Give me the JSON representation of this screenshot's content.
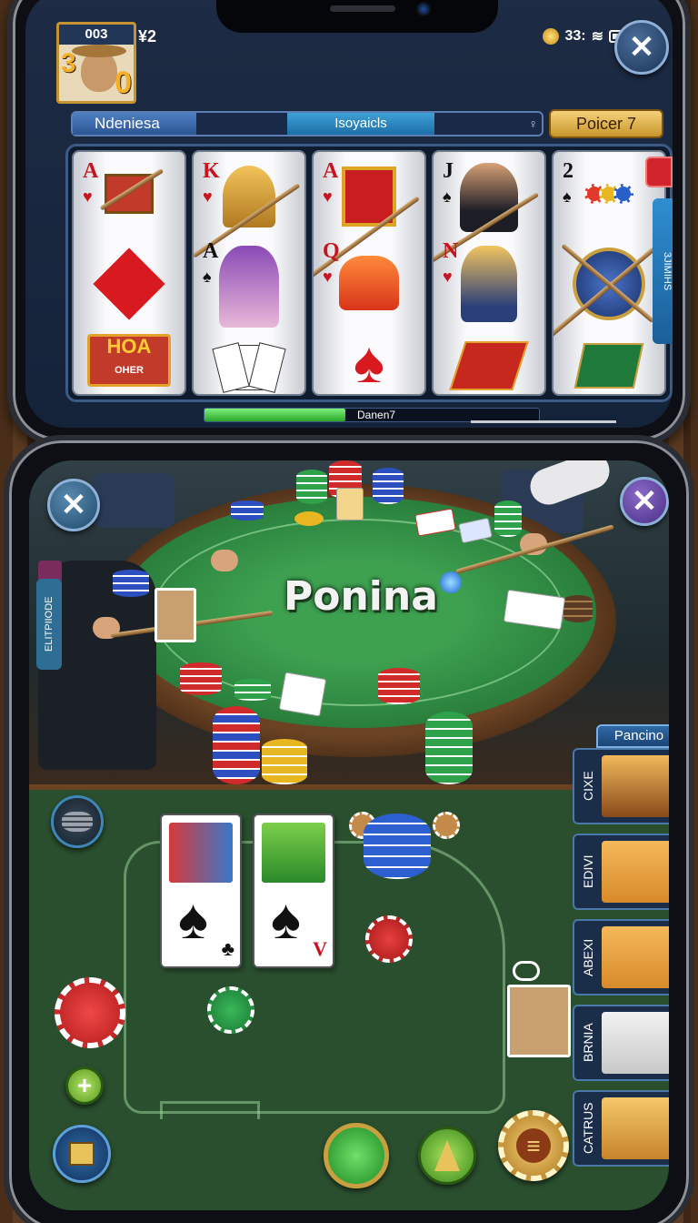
{
  "status": {
    "left_text": "¥2",
    "right_text": "33:"
  },
  "player": {
    "level": "003",
    "badge_left": "3",
    "badge_right": "0"
  },
  "top_bar": {
    "segment_1": "Ndeniesa",
    "segment_2": "Isoyaicls",
    "segment_3": "♀",
    "gold_button": "Poicer 7"
  },
  "reels": [
    {
      "rank": "A",
      "suit": "♥"
    },
    {
      "rank": "K",
      "suit": "♥"
    },
    {
      "rank": "A",
      "suit": "♥"
    },
    {
      "rank": "J",
      "suit": "♠"
    },
    {
      "rank": "2",
      "suit": "♠"
    }
  ],
  "reel_extra": {
    "hoa_text": "HOA",
    "hoa_sub": "OHER",
    "row2_rank_b": "A",
    "row2_rank_c": "Q",
    "row2_rank_d": "N"
  },
  "side_tab": "3JIMIHS",
  "progress": {
    "label": "Danen7",
    "fraction": 0.42
  },
  "table": {
    "title": "Ponina",
    "left_pill": "ELITPIIODE"
  },
  "players": {
    "header": "Pancino",
    "list": [
      {
        "name": "CIXE"
      },
      {
        "name": "EDIVI"
      },
      {
        "name": "ABEXI"
      },
      {
        "name": "BRNIA"
      },
      {
        "name": "CATRUS"
      }
    ]
  },
  "hand_cards": [
    {
      "suit": "♠",
      "corner": "♣"
    },
    {
      "suit": "♠",
      "corner": "V"
    }
  ],
  "colors": {
    "felt": "#2a6e36",
    "accent_blue": "#2e6aa8",
    "gold": "#f5c24a"
  }
}
